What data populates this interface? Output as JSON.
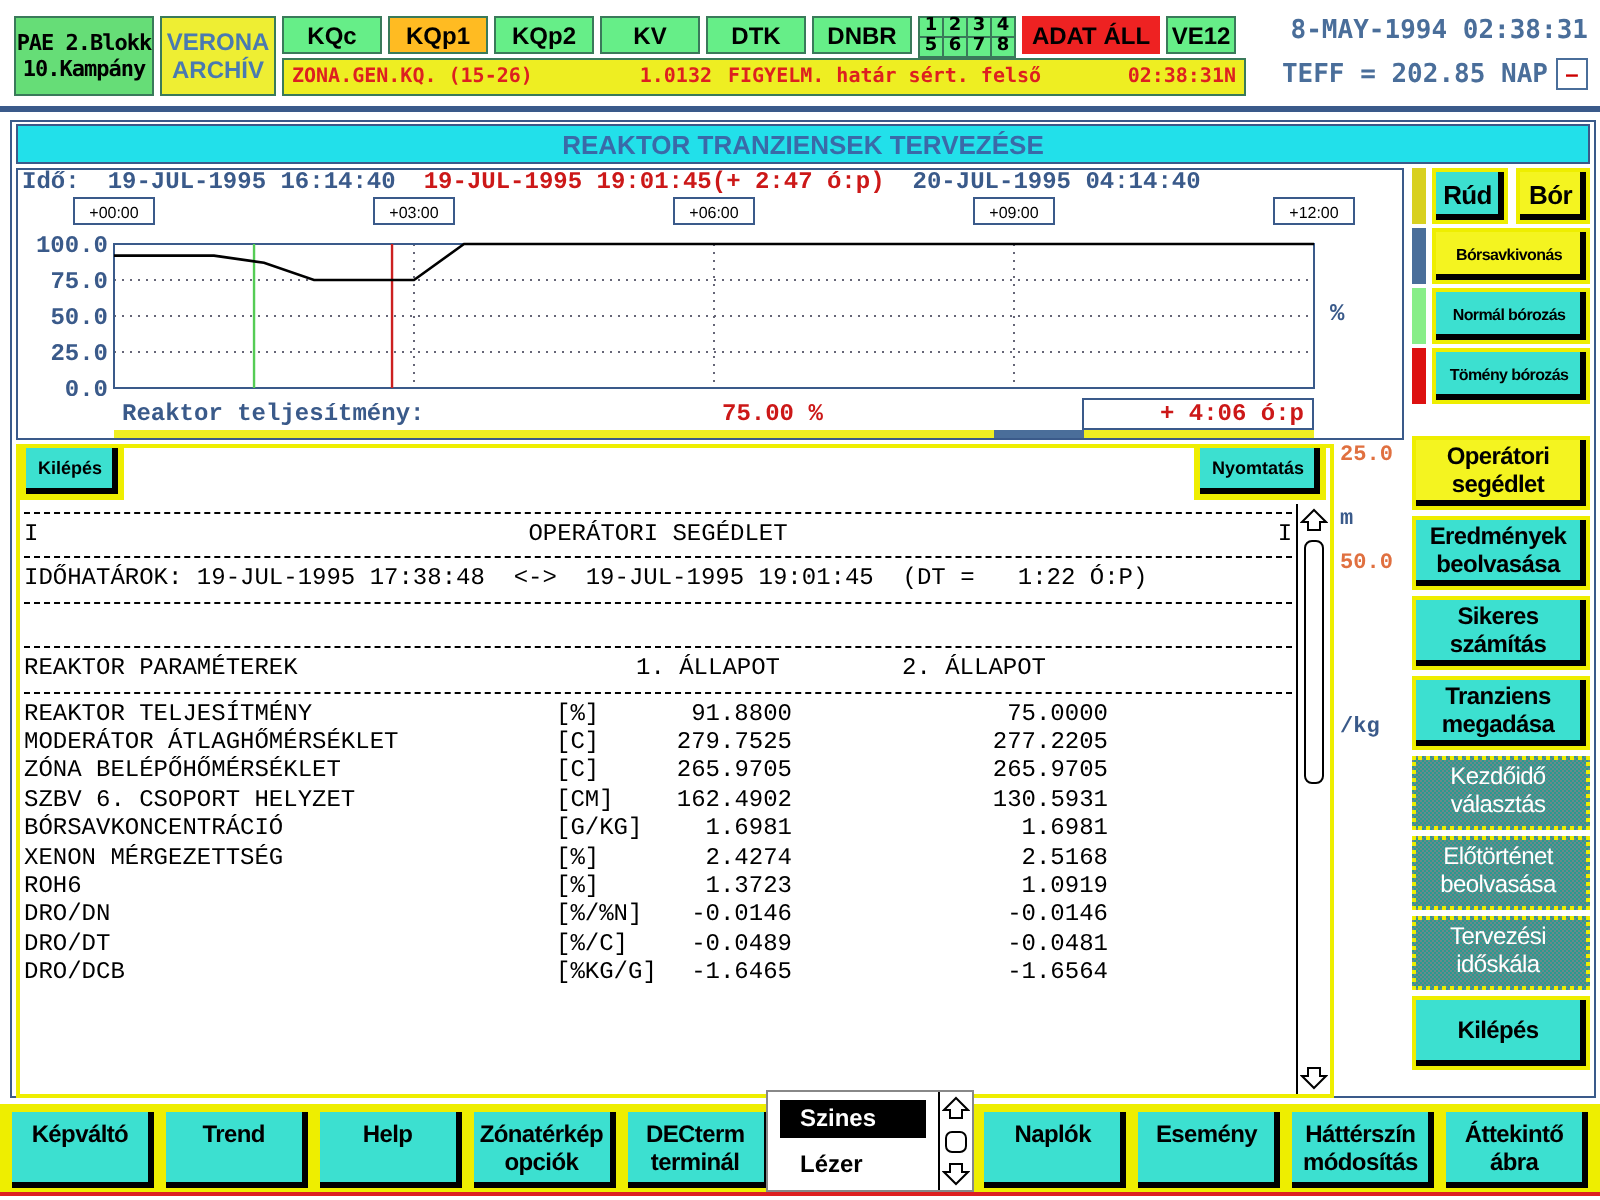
{
  "header": {
    "plant": [
      "PAE 2.Blokk",
      "10.Kampány"
    ],
    "archive": [
      "VERONA",
      "ARCHÍV"
    ],
    "tabs": [
      {
        "label": "KQc",
        "selected": false
      },
      {
        "label": "KQp1",
        "selected": true
      },
      {
        "label": "KQp2",
        "selected": false
      },
      {
        "label": "KV",
        "selected": false
      },
      {
        "label": "DTK",
        "selected": false
      },
      {
        "label": "DNBR",
        "selected": false
      }
    ],
    "digits": [
      "1",
      "2",
      "3",
      "4",
      "5",
      "6",
      "7",
      "8"
    ],
    "data_status": "ADAT ÁLL",
    "ve": "VE12",
    "alarm": {
      "signal": "ZONA.GEN.KQ. (15-26)",
      "value": "1.0132",
      "message": "FIGYELM. határ sért. felső",
      "time": "02:38:31N"
    },
    "datetime": "8-MAY-1994 02:38:31",
    "teff": "TEFF = 202.85 NAP",
    "minimize": "–"
  },
  "window_title": "REAKTOR TRANZIENSEK TERVEZÉSE",
  "trend": {
    "time_label": "Idő:",
    "start": "19-JUL-1995 16:14:40",
    "cursor": "19-JUL-1995 19:01:45(+  2:47 ó:p)",
    "end": "20-JUL-1995 04:14:40",
    "unit": "%",
    "chart_data": {
      "type": "line",
      "categories": [
        "+00:00",
        null,
        null,
        null,
        null,
        null,
        "+03:00",
        null,
        null,
        null,
        null,
        null,
        "+06:00",
        null,
        null,
        null,
        null,
        null,
        "+09:00",
        null,
        null,
        null,
        null,
        null,
        "+12:00"
      ],
      "series": [
        {
          "color": "#000000",
          "values": [
            92,
            92,
            92,
            87,
            75,
            75,
            75,
            100,
            100,
            100,
            100,
            100,
            100,
            100,
            100,
            100,
            100,
            100,
            100,
            100,
            100,
            100,
            100,
            100,
            100
          ]
        }
      ],
      "ylim": [
        0,
        100
      ],
      "yticks": [
        {
          "value": 0,
          "label": "0.0"
        },
        {
          "value": 25,
          "label": "25.0"
        },
        {
          "value": 50,
          "label": "50.0"
        },
        {
          "value": 75,
          "label": "75.0"
        },
        {
          "value": 100,
          "label": "100.0"
        }
      ],
      "grid": true
    },
    "value_label": "Reaktor teljesítmény:",
    "value": "75.00  %",
    "remaining": "+     4:06 ó:p"
  },
  "hidden_axis": [
    {
      "text": "25.0",
      "color": "#e07040"
    },
    {
      "text": "m",
      "color": "#3a5a8a"
    },
    {
      "text": "50.0",
      "color": "#e07040"
    },
    {
      "text": "/kg",
      "color": "#3a5a8a"
    }
  ],
  "control_rows": [
    {
      "color": "#d8d020",
      "buttons": [
        {
          "label": "Rúd",
          "selected": false
        },
        {
          "label": "Bór",
          "selected": true
        }
      ]
    },
    {
      "color": "#4a6e9a",
      "buttons": [
        {
          "label": "Bórsavkivonás",
          "selected": true
        }
      ]
    },
    {
      "color": "#88ee88",
      "buttons": [
        {
          "label": "Normál bórozás",
          "selected": false
        }
      ]
    },
    {
      "color": "#dd1010",
      "buttons": [
        {
          "label": "Tömény bórozás",
          "selected": false
        }
      ]
    }
  ],
  "actions": [
    {
      "label": "Operátori segédlet",
      "selected": true,
      "disabled": false
    },
    {
      "label": "Eredmények beolvasása",
      "selected": false,
      "disabled": false
    },
    {
      "label": "Sikeres számítás",
      "selected": false,
      "disabled": false
    },
    {
      "label": "Tranziens megadása",
      "selected": false,
      "disabled": false
    },
    {
      "label": "Kezdőidő választás",
      "selected": false,
      "disabled": true
    },
    {
      "label": "Előtörténet beolvasása",
      "selected": false,
      "disabled": true
    },
    {
      "label": "Tervezési időskála",
      "selected": false,
      "disabled": true
    },
    {
      "label": "Kilépés",
      "selected": false,
      "disabled": false
    }
  ],
  "report": {
    "exit": "Kilépés",
    "print": "Nyomtatás",
    "edges": [
      "I",
      "I"
    ],
    "title": "OPERÁTORI SEGÉDLET",
    "range": "IDŐHATÁROK: 19-JUL-1995 17:38:48  <->  19-JUL-1995 19:01:45  (DT =   1:22 Ó:P)",
    "columns": [
      "REAKTOR PARAMÉTEREK",
      "1. ÁLLAPOT",
      "2. ÁLLAPOT"
    ],
    "rows": [
      [
        "REAKTOR TELJESÍTMÉNY",
        "[%]",
        "91.8800",
        "75.0000"
      ],
      [
        "MODERÁTOR ÁTLAGHŐMÉRSÉKLET",
        "[C]",
        "279.7525",
        "277.2205"
      ],
      [
        "ZÓNA BELÉPŐHŐMÉRSÉKLET",
        "[C]",
        "265.9705",
        "265.9705"
      ],
      [
        "SZBV 6. CSOPORT HELYZET",
        "[CM]",
        "162.4902",
        "130.5931"
      ],
      [
        "BÓRSAVKONCENTRÁCIÓ",
        "[G/KG]",
        "1.6981",
        "1.6981"
      ],
      [
        "XENON MÉRGEZETTSÉG",
        "[%]",
        "2.4274",
        "2.5168"
      ],
      [
        "ROH6",
        "[%]",
        "1.3723",
        "1.0919"
      ],
      [
        "DRO/DN",
        "[%/%N]",
        "-0.0146",
        "-0.0146"
      ],
      [
        "DRO/DT",
        "[%/C]",
        "-0.0489",
        "-0.0481"
      ],
      [
        "DRO/DCB",
        "[%KG/G]",
        "-1.6465",
        "-1.6564"
      ]
    ]
  },
  "bottom_left": [
    "Képváltó",
    "Trend",
    "Help",
    "Zónatérkép opciók",
    "DECterm terminál"
  ],
  "bottom_right": [
    "Naplók",
    "Esemény",
    "Háttérszín módosítás",
    "Áttekintő ábra"
  ],
  "print_menu": [
    {
      "label": "Szines",
      "selected": true
    },
    {
      "label": "Lézer",
      "selected": false
    }
  ]
}
